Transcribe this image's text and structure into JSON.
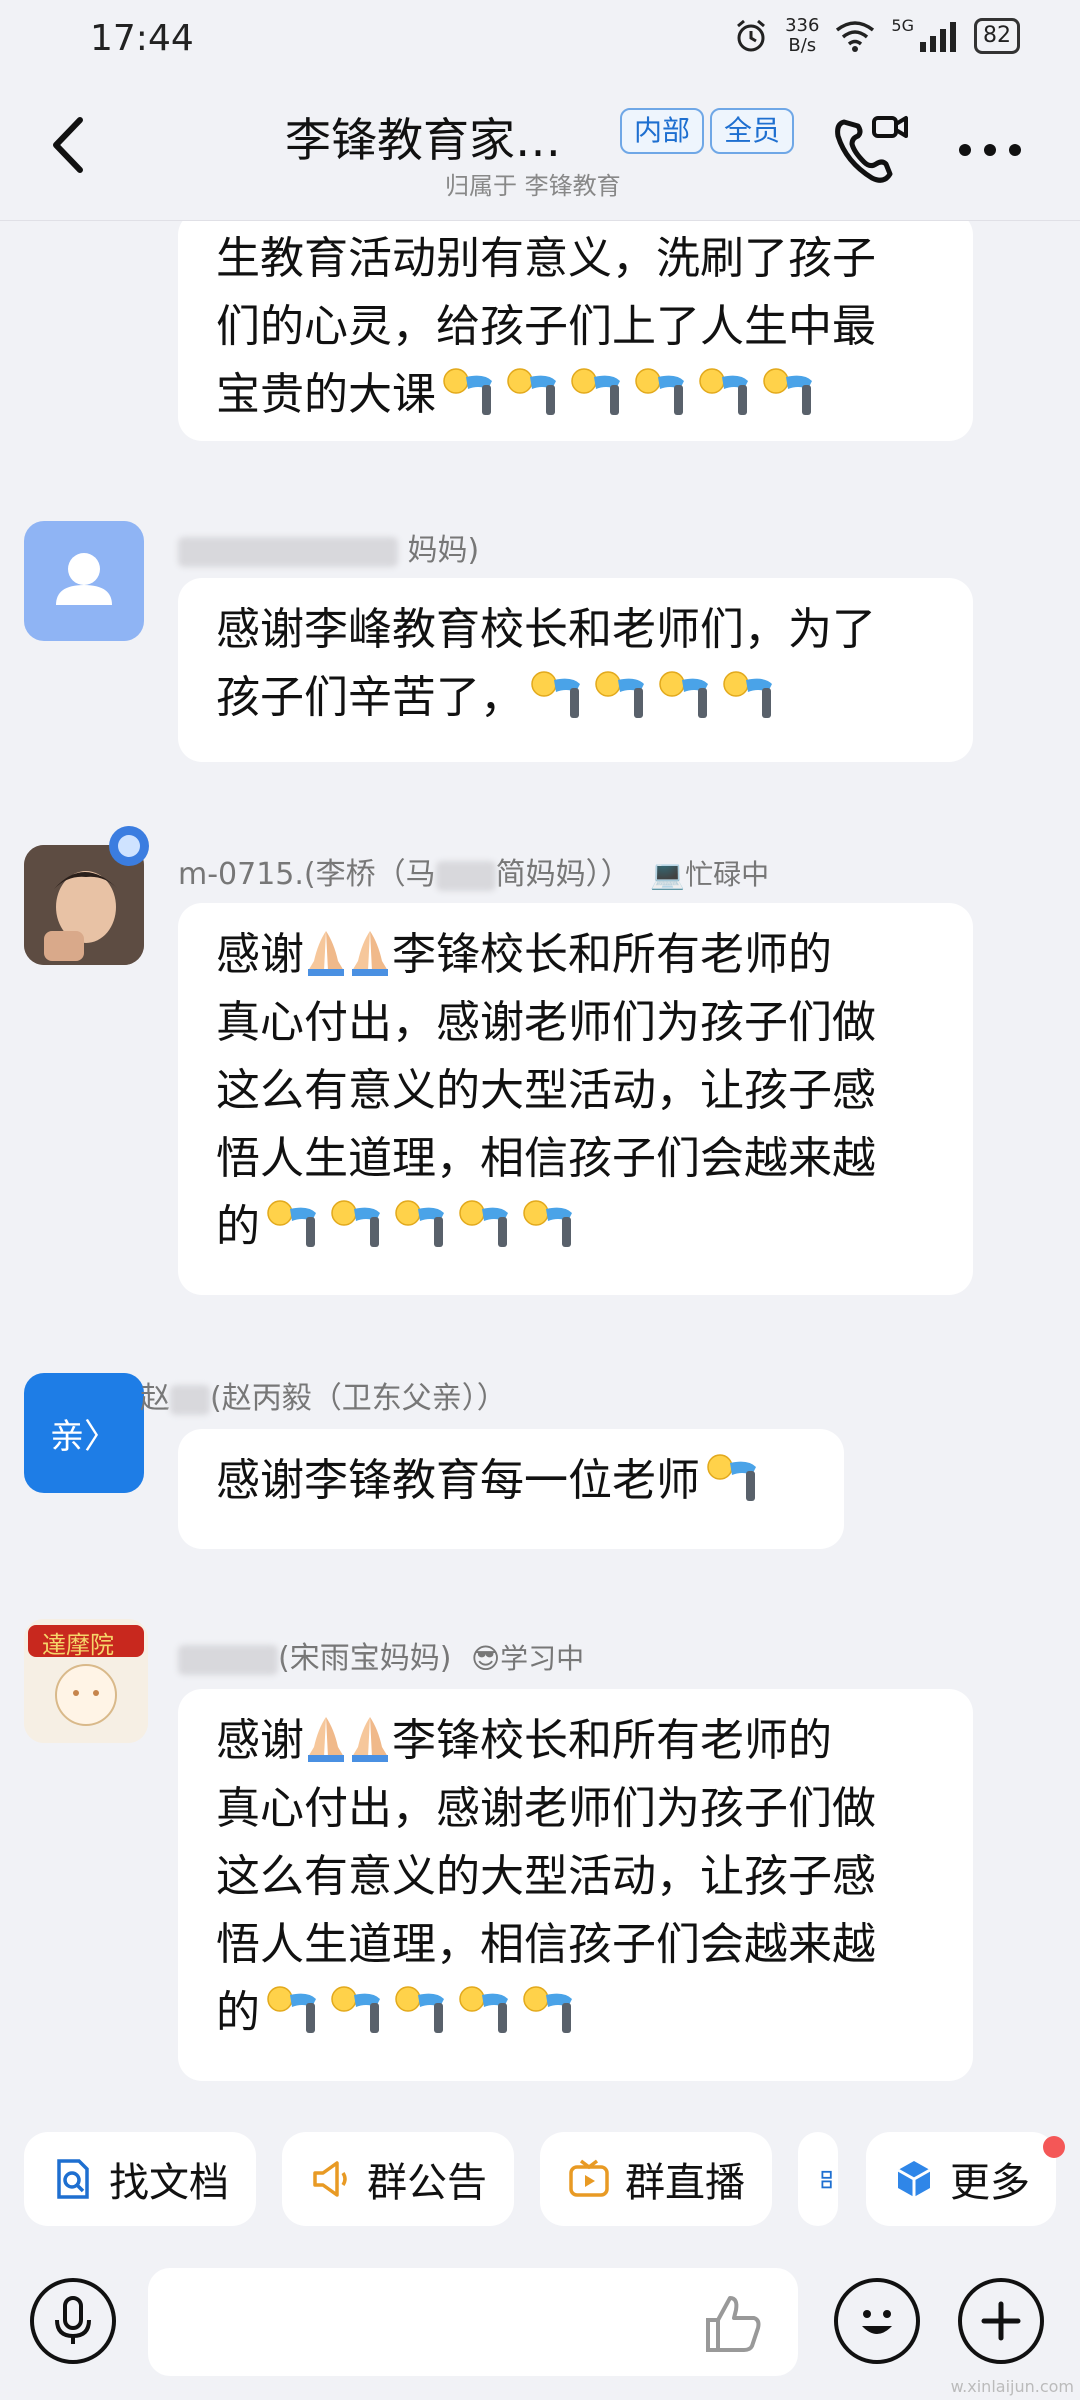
{
  "status": {
    "time": "17:44",
    "net_speed_value": "336",
    "net_speed_unit": "B/s",
    "signal_label": "5G",
    "battery": "82"
  },
  "header": {
    "title": "李锋教育家…",
    "badge_internal": "内部",
    "badge_all": "全员",
    "subtitle": "归属于 李锋教育"
  },
  "messages": [
    {
      "lines": [
        "生教育活动别有意义，洗刷了孩子",
        "们的心灵，给孩子们上了人生中最",
        "宝贵的大课"
      ]
    },
    {
      "sender_visible": "妈妈)",
      "lines": [
        "感谢李峰教育校长和老师们，为了",
        "孩子们辛苦了，"
      ]
    },
    {
      "sender_visible": "m-0715.(李桥（马",
      "sender_visible2": "简妈妈））",
      "status_text": "忙碌中",
      "line1_a": "感谢",
      "line1_b": "李锋校长和所有老师的",
      "lines": [
        "真心付出，感谢老师们为孩子们做",
        "这么有意义的大型活动，让孩子感",
        "悟人生道理，相信孩子们会越来越"
      ],
      "last_line": "的"
    },
    {
      "avatar_text": "亲〉",
      "sender_visible": "赵",
      "sender_visible2": "(赵丙毅（卫东父亲））",
      "lines": [
        "感谢李锋教育每一位老师"
      ]
    },
    {
      "avatar_text": "達摩院",
      "sender_visible": "(宋雨宝妈妈)",
      "status_text": "学习中",
      "line1_a": "感谢",
      "line1_b": "李锋校长和所有老师的",
      "lines": [
        "真心付出，感谢老师们为孩子们做",
        "这么有意义的大型活动，让孩子感",
        "悟人生道理，相信孩子们会越来越"
      ],
      "last_line": "的"
    }
  ],
  "quickbar": {
    "find_docs": "找文档",
    "announcement": "群公告",
    "live": "群直播",
    "more": "更多"
  },
  "watermark": "w.xinlaijun.com",
  "colors": {
    "accent_blue": "#1e6fd0",
    "red_dot": "#f45757",
    "bg": "#f1f2f6"
  }
}
